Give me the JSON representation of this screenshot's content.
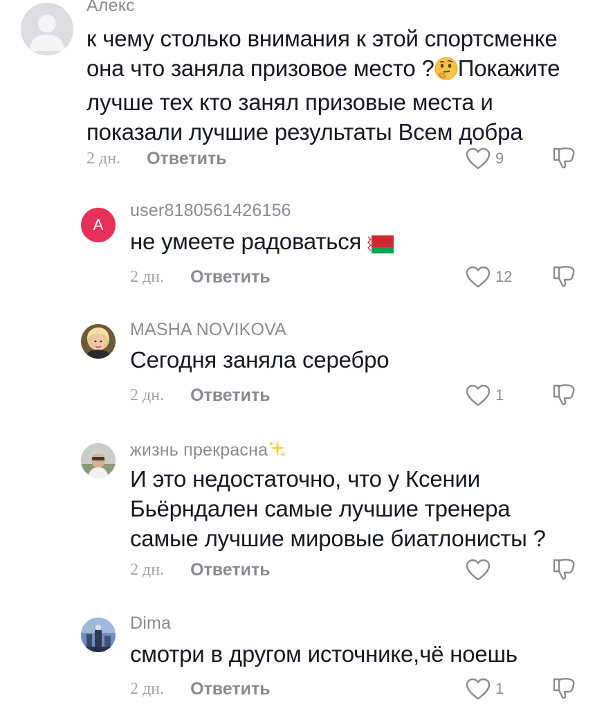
{
  "comments": [
    {
      "username": "Алекс",
      "lines": [
        "к чему столько внимания к этой спортсменке",
        "она что заняла призовое место ?",
        "Покажите",
        "лучше тех кто занял призовые места и",
        "показали лучшие результаты Всем добра"
      ],
      "date": "2 дн.",
      "reply": "Ответить",
      "likes": "9",
      "avatar_icon": "default-user-icon"
    },
    {
      "username": "user8180561426156",
      "lines": [
        "не умеете радоваться"
      ],
      "date": "2 дн.",
      "reply": "Ответить",
      "likes": "12",
      "avatar_letter": "A",
      "avatar_color": "#e7305a"
    },
    {
      "username": "MASHA NOVIKOVA",
      "lines": [
        "Сегодня заняла серебро"
      ],
      "date": "2 дн.",
      "reply": "Ответить",
      "likes": "1"
    },
    {
      "username": "жизнь прекрасна",
      "lines": [
        "И это недостаточно, что у Ксении",
        "Бьёрндален самые лучшие тренера",
        "самые лучшие мировые биатлонисты ?"
      ],
      "date": "2 дн.",
      "reply": "Ответить",
      "likes": ""
    },
    {
      "username": "Dima",
      "lines": [
        "смотри в другом источнике,чё ноешь"
      ],
      "date": "2 дн.",
      "reply": "Ответить",
      "likes": "1"
    }
  ],
  "icons": {
    "like": "heart-outline-icon",
    "dislike": "thumbs-down-icon",
    "thinking": "thinking-face-emoji",
    "flag": "belarus-flag-emoji",
    "sparkles": "sparkles-emoji"
  },
  "colors": {
    "text": "#161823",
    "muted": "#8a8b91",
    "avatar_accent": "#e7305a"
  }
}
